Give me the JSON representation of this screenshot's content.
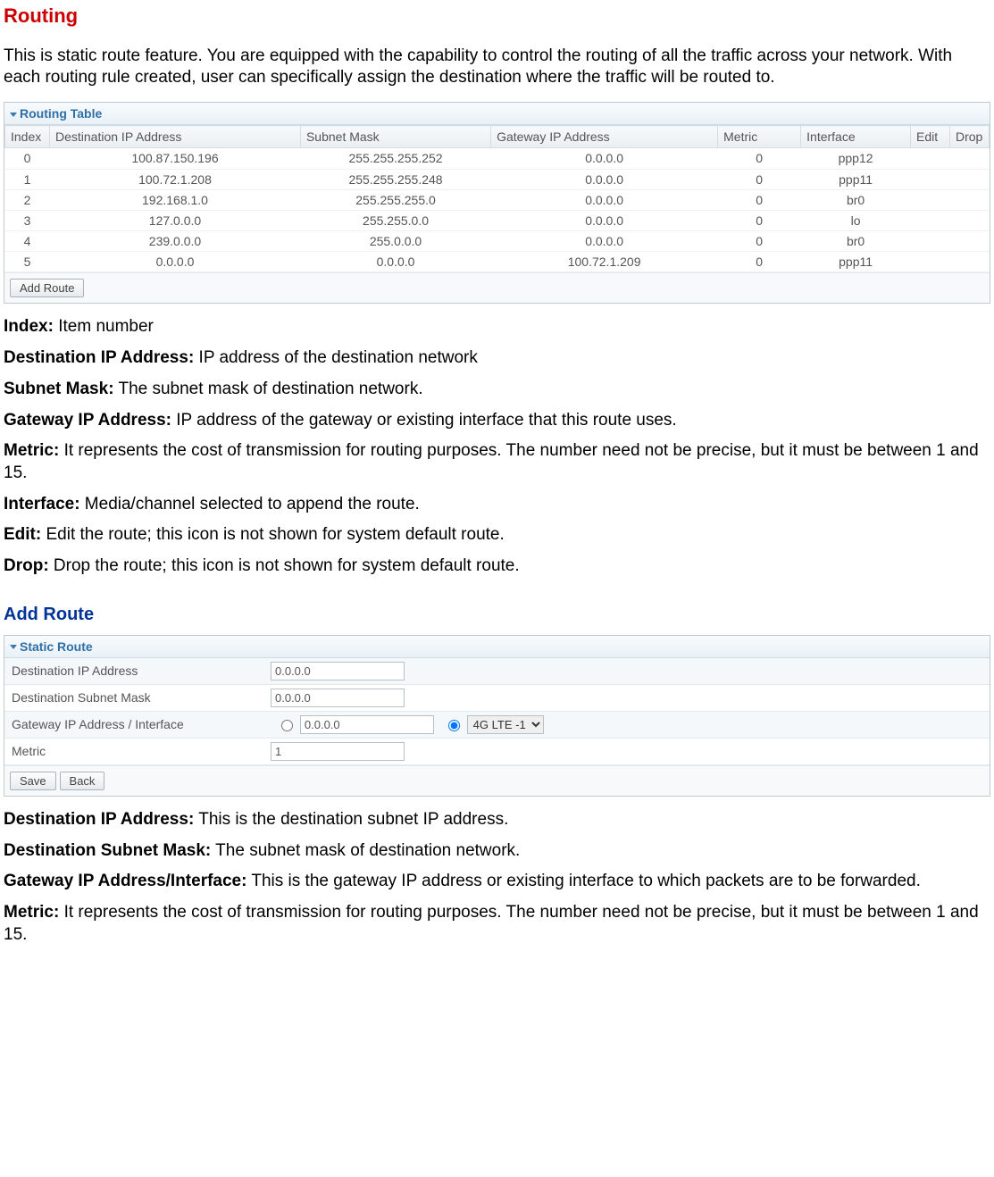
{
  "headings": {
    "routing": "Routing",
    "add_route": "Add Route"
  },
  "intro": "This is static route feature. You are equipped with the capability to control the routing of all the traffic across your network. With each routing rule created, user can specifically assign the destination where the traffic will be routed to.",
  "routing_table": {
    "title": "Routing Table",
    "columns": [
      "Index",
      "Destination IP Address",
      "Subnet Mask",
      "Gateway IP Address",
      "Metric",
      "Interface",
      "Edit",
      "Drop"
    ],
    "rows": [
      {
        "index": "0",
        "dest": "100.87.150.196",
        "mask": "255.255.255.252",
        "gateway": "0.0.0.0",
        "metric": "0",
        "iface": "ppp12"
      },
      {
        "index": "1",
        "dest": "100.72.1.208",
        "mask": "255.255.255.248",
        "gateway": "0.0.0.0",
        "metric": "0",
        "iface": "ppp11"
      },
      {
        "index": "2",
        "dest": "192.168.1.0",
        "mask": "255.255.255.0",
        "gateway": "0.0.0.0",
        "metric": "0",
        "iface": "br0"
      },
      {
        "index": "3",
        "dest": "127.0.0.0",
        "mask": "255.255.0.0",
        "gateway": "0.0.0.0",
        "metric": "0",
        "iface": "lo"
      },
      {
        "index": "4",
        "dest": "239.0.0.0",
        "mask": "255.0.0.0",
        "gateway": "0.0.0.0",
        "metric": "0",
        "iface": "br0"
      },
      {
        "index": "5",
        "dest": "0.0.0.0",
        "mask": "0.0.0.0",
        "gateway": "100.72.1.209",
        "metric": "0",
        "iface": "ppp11"
      }
    ],
    "add_button": "Add Route"
  },
  "defs1": [
    {
      "term": "Index:",
      "text": " Item number"
    },
    {
      "term": "Destination IP Address:",
      "text": " IP address of the destination network"
    },
    {
      "term": "Subnet Mask:",
      "text": " The subnet mask of destination network."
    },
    {
      "term": "Gateway IP Address:",
      "text": " IP address of the gateway or existing interface that this route uses."
    },
    {
      "term": "Metric:",
      "text": " It represents the cost of transmission for routing purposes. The number need not be precise, but it must be between 1 and 15."
    },
    {
      "term": "Interface:",
      "text": " Media/channel selected to append the route."
    },
    {
      "term": "Edit:",
      "text": " Edit the route; this icon is not shown for system default route."
    },
    {
      "term": "Drop:",
      "text": " Drop the route; this icon is not shown for system default route."
    }
  ],
  "static_route": {
    "title": "Static Route",
    "rows": {
      "dest_ip": {
        "label": "Destination IP Address",
        "value": "0.0.0.0"
      },
      "dest_mask": {
        "label": "Destination Subnet Mask",
        "value": "0.0.0.0"
      },
      "gateway": {
        "label": "Gateway IP Address / Interface",
        "ip_value": "0.0.0.0",
        "select_value": "4G LTE -1"
      },
      "metric": {
        "label": "Metric",
        "value": "1"
      }
    },
    "buttons": {
      "save": "Save",
      "back": "Back"
    }
  },
  "defs2": [
    {
      "term": "Destination IP Address:",
      "text": " This is the destination subnet IP address."
    },
    {
      "term": "Destination Subnet Mask:",
      "text": " The subnet mask of destination network."
    },
    {
      "term": "Gateway IP Address/Interface:",
      "text": " This is the gateway IP address or existing interface to which packets are to be forwarded."
    },
    {
      "term": "Metric:",
      "text": " It represents the cost of transmission for routing purposes. The number need not be precise, but it must be between 1 and 15."
    }
  ]
}
